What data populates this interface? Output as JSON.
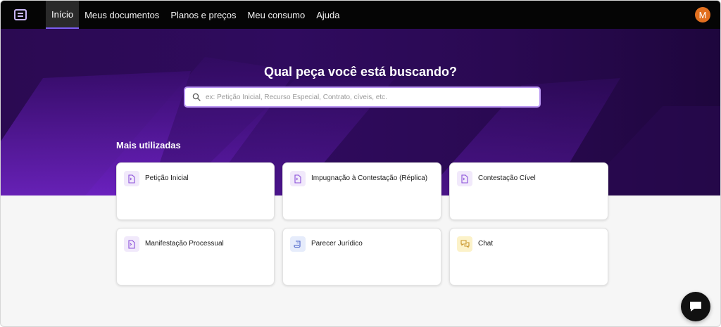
{
  "nav": {
    "items": [
      {
        "label": "Início",
        "active": true
      },
      {
        "label": "Meus documentos",
        "active": false
      },
      {
        "label": "Planos e preços",
        "active": false
      },
      {
        "label": "Meu consumo",
        "active": false
      },
      {
        "label": "Ajuda",
        "active": false
      }
    ],
    "avatar_initial": "M",
    "avatar_color": "#e2701f"
  },
  "hero": {
    "title": "Qual peça você está buscando?",
    "search_placeholder": "ex: Petição Inicial, Recurso Especial, Contrato, cíveis, etc."
  },
  "section": {
    "title": "Mais utilizadas"
  },
  "cards": [
    {
      "label": "Petição Inicial",
      "icon": "document-icon",
      "icon_bg": "#f1e9fb",
      "icon_color": "#8a4fd8"
    },
    {
      "label": "Impugnação à Contestação (Réplica)",
      "icon": "document-icon",
      "icon_bg": "#f1e9fb",
      "icon_color": "#8a4fd8"
    },
    {
      "label": "Contestação Cível",
      "icon": "document-icon",
      "icon_bg": "#f1e9fb",
      "icon_color": "#8a4fd8"
    },
    {
      "label": "Manifestação Processual",
      "icon": "document-icon",
      "icon_bg": "#f1e9fb",
      "icon_color": "#8a4fd8"
    },
    {
      "label": "Parecer Jurídico",
      "icon": "scroll-icon",
      "icon_bg": "#e6ecfb",
      "icon_color": "#4a63c9"
    },
    {
      "label": "Chat",
      "icon": "chat-icon",
      "icon_bg": "#fcf2c9",
      "icon_color": "#c9952a"
    }
  ],
  "colors": {
    "accent": "#7b5cf0",
    "hero_dark": "#2b0a52",
    "hero_highlight": "#6d22c7"
  }
}
